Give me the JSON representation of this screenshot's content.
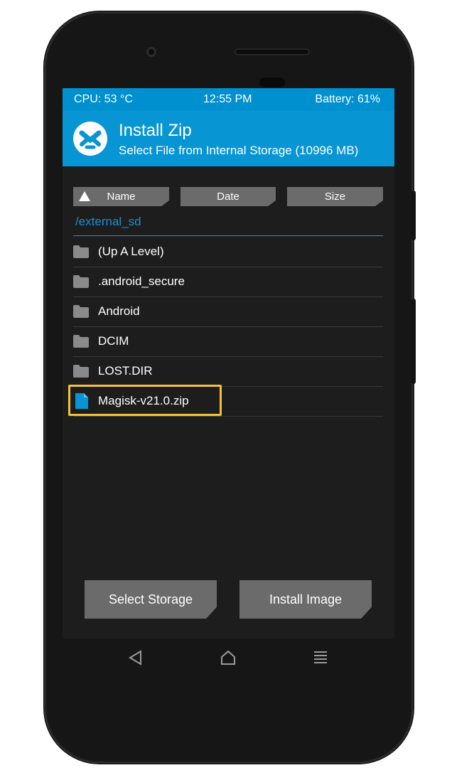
{
  "status": {
    "cpu": "CPU: 53 °C",
    "time": "12:55 PM",
    "battery": "Battery: 61%"
  },
  "header": {
    "title": "Install Zip",
    "subtitle": "Select File from Internal Storage (10996 MB)",
    "logo_icon": "twrp-logo-icon"
  },
  "sort": {
    "name": "Name",
    "date": "Date",
    "size": "Size",
    "direction_icon": "sort-ascending-icon"
  },
  "path": "/external_sd",
  "files": [
    {
      "label": "(Up A Level)",
      "type": "folder"
    },
    {
      "label": ".android_secure",
      "type": "folder"
    },
    {
      "label": "Android",
      "type": "folder"
    },
    {
      "label": "DCIM",
      "type": "folder"
    },
    {
      "label": "LOST.DIR",
      "type": "folder"
    },
    {
      "label": "Magisk-v21.0.zip",
      "type": "file"
    }
  ],
  "buttons": {
    "select_storage": "Select Storage",
    "install_image": "Install Image"
  },
  "navbar": [
    "back-icon",
    "home-icon",
    "menu-icon"
  ],
  "colors": {
    "accent": "#0795d4",
    "highlight": "#f1c33a",
    "button": "#6b6b6b"
  }
}
